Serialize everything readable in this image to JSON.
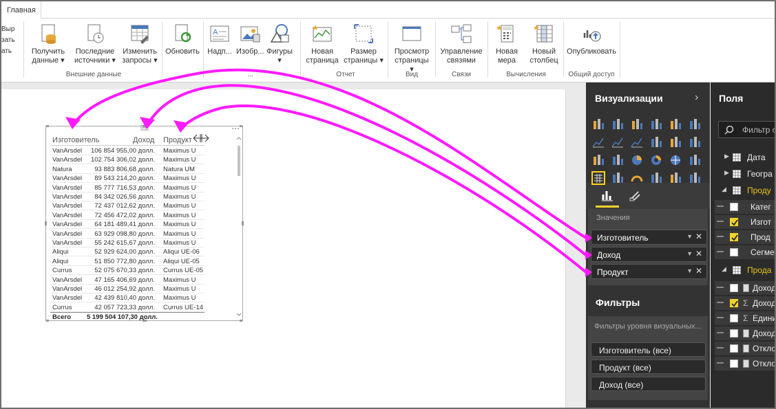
{
  "ribbon": {
    "tab_home": "Главная",
    "edge_text": [
      "Выр",
      "зать",
      "ать"
    ],
    "buttons": {
      "get_data": [
        "Получить",
        "данные ▾"
      ],
      "recent_sources": [
        "Последние",
        "источники ▾"
      ],
      "edit_queries": [
        "Изменить",
        "запросы ▾"
      ],
      "refresh": "Обновить",
      "text_box": "Надп...",
      "image": "Изобр...",
      "shapes": [
        "Фигуры",
        "▾"
      ],
      "new_page": [
        "Новая",
        "страница"
      ],
      "page_size": [
        "Размер",
        "страницы ▾"
      ],
      "page_view": [
        "Просмотр",
        "страницы",
        "▾"
      ],
      "manage_relationships": [
        "Управление",
        "связями"
      ],
      "new_measure": [
        "Новая",
        "мера"
      ],
      "new_column": [
        "Новый",
        "столбец"
      ],
      "publish": "Опубликовать"
    },
    "groups": {
      "external_data": "Внешние данные",
      "insert_dot": "...",
      "report": "Отчет",
      "view": "Вид",
      "relationships": "Связи",
      "calculations": "Вычисления",
      "share": "Общий доступ"
    }
  },
  "table": {
    "headers": [
      "Изготовитель",
      "Доход",
      "Продукт"
    ],
    "rows": [
      [
        "VanArsdel",
        "106 854 955,00 долл.",
        "Maximus U"
      ],
      [
        "VanArsdel",
        "102 754 306,02 долл.",
        "Maximus U"
      ],
      [
        "Natura",
        "93 883 806,68 долл.",
        "Natura UM"
      ],
      [
        "VanArsdel",
        "89 543 214,20 долл.",
        "Maximus U"
      ],
      [
        "VanArsdel",
        "85 777 716,53 долл.",
        "Maximus U"
      ],
      [
        "VanArsdel",
        "84 342 026,56 долл.",
        "Maximus U"
      ],
      [
        "VanArsdel",
        "72 437 012,62 долл.",
        "Maximus U"
      ],
      [
        "VanArsdel",
        "72 456 472,02 долл.",
        "Maximus U"
      ],
      [
        "VanArsdel",
        "64 181 489,41 долл.",
        "Maximus U"
      ],
      [
        "VanArsdel",
        "63 929 098,80 долл.",
        "Maximus U"
      ],
      [
        "VanArsdel",
        "55 242 615,67 долл.",
        "Maximus U"
      ],
      [
        "Aliqui",
        "52 929 624,00 долл.",
        "Aliqui UE-06"
      ],
      [
        "Aliqui",
        "51 850 772,80 долл.",
        "Aliqui UE-05"
      ],
      [
        "Currus",
        "52 075 670,33 долл.",
        "Currus UE-05"
      ],
      [
        "VanArsdel",
        "47 165 406,69 долл.",
        "Maximus U"
      ],
      [
        "VanArsdel",
        "46 012 254,92 долл.",
        "Maximus U"
      ],
      [
        "VanArsdel",
        "42 439 810,40 долл.",
        "Maximus U"
      ],
      [
        "Currus",
        "42 057 723,33 долл.",
        "Currus UE-14"
      ]
    ],
    "total_label": "Всего",
    "total_value": "5 199 504 107,30 долл."
  },
  "viz_pane": {
    "title": "Визуализации",
    "chevron": "›",
    "values_title": "Значения",
    "wells": [
      "Изготовитель",
      "Доход",
      "Продукт"
    ],
    "filters_title": "Фильтры",
    "filters_subtitle": "Фильтры уровня визуальных...",
    "filter_wells": [
      "Изготовитель (все)",
      "Продукт (все)",
      "Доход (все)"
    ]
  },
  "fields_pane": {
    "title": "Поля",
    "search_placeholder": "Фильтр с",
    "tables": [
      "Дата",
      "Геогра",
      "Проду",
      "Прода"
    ],
    "product_fields": [
      "Катег",
      "Изгот",
      "Прод",
      "Сегме"
    ],
    "sales_fields": [
      "Доход",
      "Доход",
      "Едини",
      "Доход",
      "Откло",
      "Откло"
    ]
  },
  "colors": {
    "arrow": "#ff1aff",
    "pane_dark": "#333333",
    "highlight_yellow": "#f3d32b"
  }
}
